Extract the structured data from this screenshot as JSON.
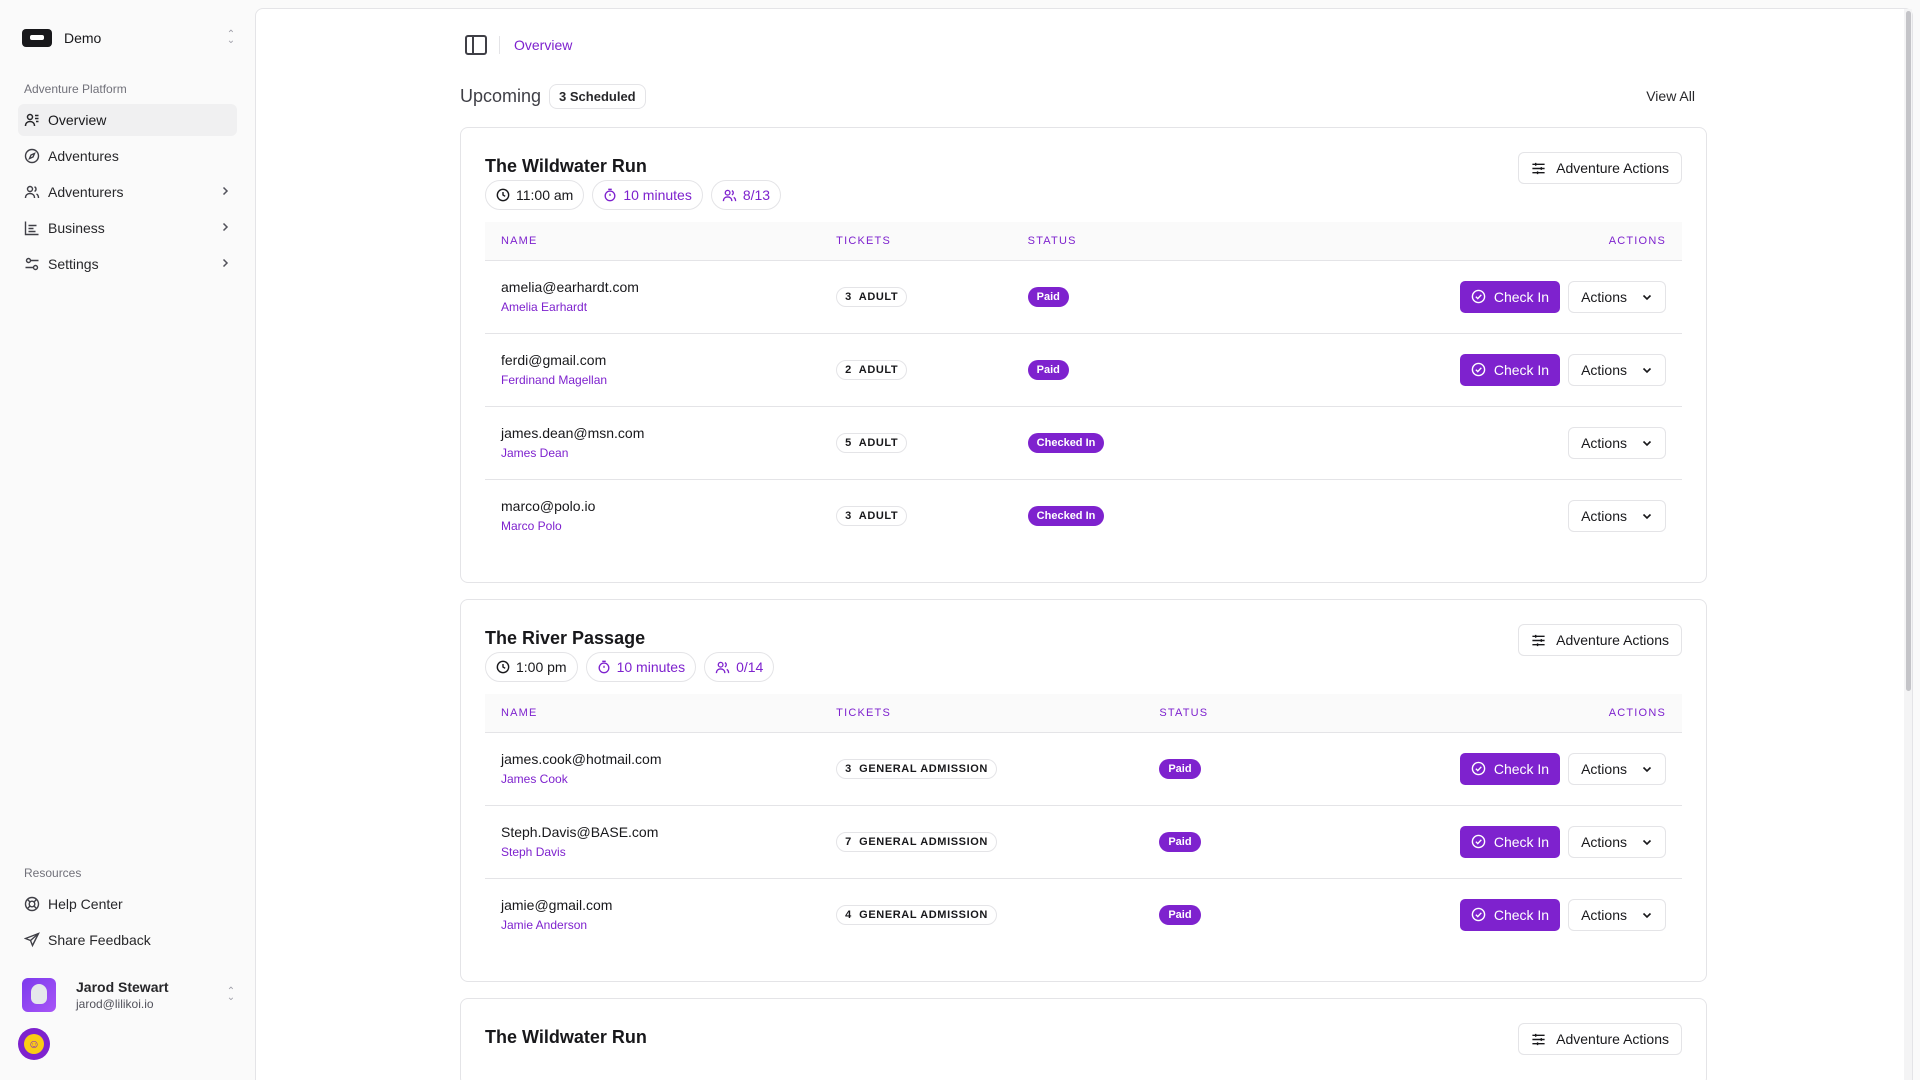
{
  "app": {
    "team_name": "Demo",
    "platform_section": "Adventure Platform",
    "resources_section": "Resources"
  },
  "sidebar": {
    "items": [
      {
        "label": "Overview",
        "icon": "overview-icon",
        "active": true
      },
      {
        "label": "Adventures",
        "icon": "compass-icon"
      },
      {
        "label": "Adventurers",
        "icon": "users-icon",
        "has_children": true
      },
      {
        "label": "Business",
        "icon": "chart-icon",
        "has_children": true
      },
      {
        "label": "Settings",
        "icon": "sliders-icon",
        "has_children": true
      }
    ],
    "resources": [
      {
        "label": "Help Center",
        "icon": "lifebuoy-icon"
      },
      {
        "label": "Share Feedback",
        "icon": "send-icon"
      }
    ]
  },
  "user": {
    "name": "Jarod Stewart",
    "email": "jarod@lilikoi.io"
  },
  "header": {
    "breadcrumb": "Overview"
  },
  "upcoming": {
    "title": "Upcoming",
    "badge": "3 Scheduled",
    "view_all": "View All"
  },
  "table_headers": {
    "name": "NAME",
    "tickets": "TICKETS",
    "status": "STATUS",
    "actions": "ACTIONS"
  },
  "labels": {
    "adventure_actions": "Adventure Actions",
    "check_in": "Check In",
    "actions": "Actions"
  },
  "colors": {
    "accent": "#7e22ce"
  },
  "adventures": [
    {
      "title": "The Wildwater Run",
      "time": "11:00 am",
      "duration": "10 minutes",
      "capacity": "8/13",
      "rows": [
        {
          "email": "amelia@earhardt.com",
          "name": "Amelia Earhardt",
          "ticket": "3  ADULT",
          "status": "Paid",
          "can_check_in": true
        },
        {
          "email": "ferdi@gmail.com",
          "name": "Ferdinand Magellan",
          "ticket": "2  ADULT",
          "status": "Paid",
          "can_check_in": true
        },
        {
          "email": "james.dean@msn.com",
          "name": "James Dean",
          "ticket": "5  ADULT",
          "status": "Checked In",
          "can_check_in": false
        },
        {
          "email": "marco@polo.io",
          "name": "Marco Polo",
          "ticket": "3  ADULT",
          "status": "Checked In",
          "can_check_in": false
        }
      ]
    },
    {
      "title": "The River Passage",
      "time": "1:00 pm",
      "duration": "10 minutes",
      "capacity": "0/14",
      "rows": [
        {
          "email": "james.cook@hotmail.com",
          "name": "James Cook",
          "ticket": "3  GENERAL ADMISSION",
          "status": "Paid",
          "can_check_in": true
        },
        {
          "email": "Steph.Davis@BASE.com",
          "name": "Steph Davis",
          "ticket": "7  GENERAL ADMISSION",
          "status": "Paid",
          "can_check_in": true
        },
        {
          "email": "jamie@gmail.com",
          "name": "Jamie Anderson",
          "ticket": "4  GENERAL ADMISSION",
          "status": "Paid",
          "can_check_in": true
        }
      ]
    },
    {
      "title": "The Wildwater Run",
      "rows": []
    }
  ]
}
